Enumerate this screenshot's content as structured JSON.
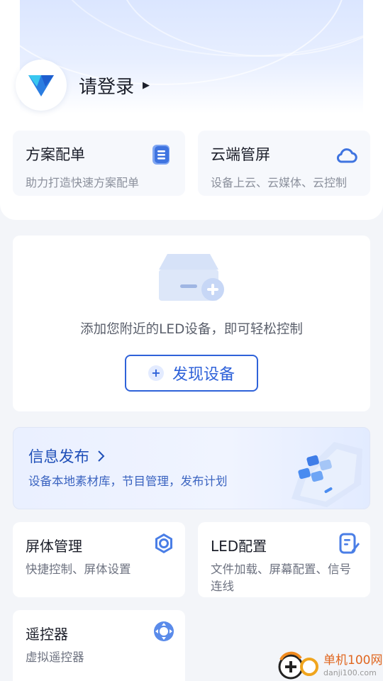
{
  "header": {
    "login_label": "请登录"
  },
  "features": [
    {
      "title": "方案配单",
      "subtitle": "助力打造快速方案配单",
      "icon": "document-icon"
    },
    {
      "title": "云端管屏",
      "subtitle": "设备上云、云媒体、云控制",
      "icon": "cloud-icon"
    }
  ],
  "device": {
    "hint": "添加您附近的LED设备，即可轻松控制",
    "discover_label": "发现设备"
  },
  "publish": {
    "title": "信息发布",
    "subtitle": "设备本地素材库，节目管理，发布计划"
  },
  "tools": [
    {
      "title": "屏体管理",
      "subtitle": "快捷控制、屏体设置",
      "icon": "hexagon-icon"
    },
    {
      "title": "LED配置",
      "subtitle": "文件加载、屏幕配置、信号连线",
      "icon": "edit-document-icon"
    },
    {
      "title": "遥控器",
      "subtitle": "虚拟遥控器",
      "icon": "remote-control-icon"
    }
  ],
  "watermark": {
    "name": "单机100网",
    "url": "danji100.com"
  },
  "colors": {
    "accent": "#2f62d9",
    "background": "#f3f5f9",
    "icon_blue": "#4a7ee6"
  }
}
